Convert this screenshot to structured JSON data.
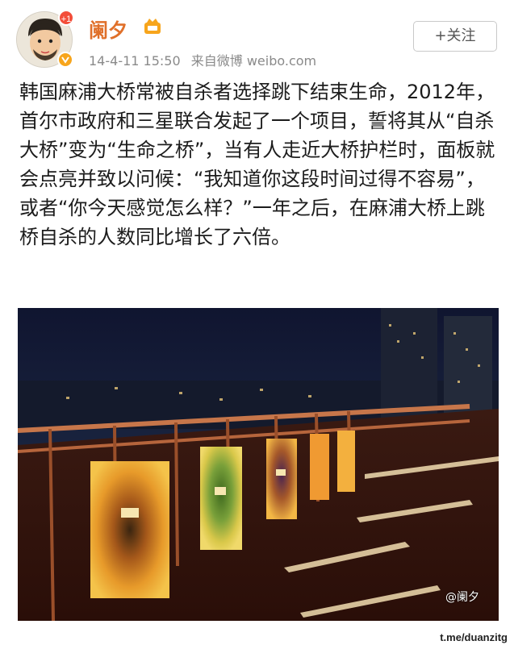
{
  "post": {
    "avatar_notification": "+1",
    "username": "阑夕",
    "timestamp": "14-4-11 15:50",
    "source": "来自微博 weibo.com",
    "follow_label": "+关注",
    "text": "韩国麻浦大桥常被自杀者选择跳下结束生命，2012年，首尔市政府和三星联合发起了一个项目，誓将其从“自杀大桥”变为“生命之桥”，当有人走近大桥护栏时，面板就会点亮并致以问候：“我知道你这段时间过得不容易”，或者“你今天感觉怎么样？”一年之后，在麻浦大桥上跳桥自杀的人数同比增长了六倍。",
    "image_watermark": "@阑夕"
  },
  "footer": {
    "channel_label": "t.me/duanzitg"
  },
  "colors": {
    "username": "#e0702a",
    "badge": "#f34e3a",
    "verified": "#f7a51c"
  }
}
